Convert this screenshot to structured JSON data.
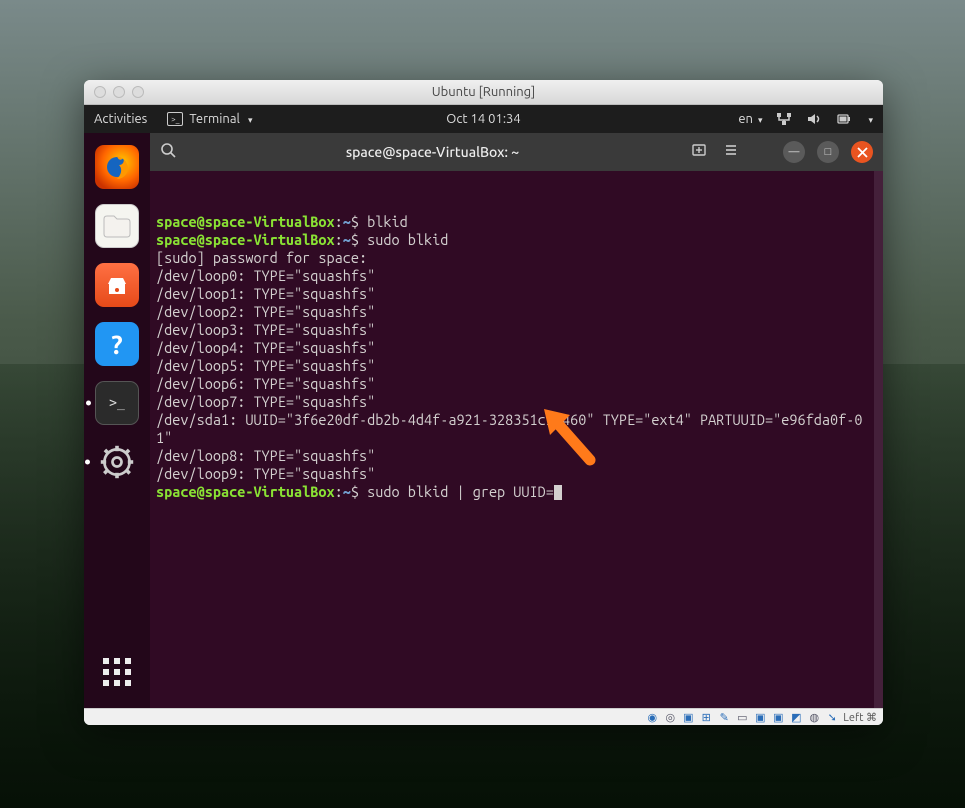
{
  "vm": {
    "title": "Ubuntu [Running]",
    "statusbar_text": "Left ⌘"
  },
  "topbar": {
    "activities": "Activities",
    "app_name": "Terminal",
    "datetime": "Oct 14  01:34",
    "lang": "en"
  },
  "dock": {
    "items": [
      "firefox",
      "files",
      "software",
      "help",
      "terminal",
      "settings",
      "apps"
    ]
  },
  "terminal": {
    "title": "space@space-VirtualBox: ~",
    "prompt_user": "space@space-VirtualBox",
    "prompt_path": "~",
    "lines": [
      {
        "type": "prompt",
        "cmd": "blkid"
      },
      {
        "type": "prompt",
        "cmd": "sudo blkid"
      },
      {
        "type": "out",
        "text": "[sudo] password for space:"
      },
      {
        "type": "out",
        "text": "/dev/loop0: TYPE=\"squashfs\""
      },
      {
        "type": "out",
        "text": "/dev/loop1: TYPE=\"squashfs\""
      },
      {
        "type": "out",
        "text": "/dev/loop2: TYPE=\"squashfs\""
      },
      {
        "type": "out",
        "text": "/dev/loop3: TYPE=\"squashfs\""
      },
      {
        "type": "out",
        "text": "/dev/loop4: TYPE=\"squashfs\""
      },
      {
        "type": "out",
        "text": "/dev/loop5: TYPE=\"squashfs\""
      },
      {
        "type": "out",
        "text": "/dev/loop6: TYPE=\"squashfs\""
      },
      {
        "type": "out",
        "text": "/dev/loop7: TYPE=\"squashfs\""
      },
      {
        "type": "out",
        "text": "/dev/sda1: UUID=\"3f6e20df-db2b-4d4f-a921-328351c93460\" TYPE=\"ext4\" PARTUUID=\"e96fda0f-01\""
      },
      {
        "type": "out",
        "text": "/dev/loop8: TYPE=\"squashfs\""
      },
      {
        "type": "out",
        "text": "/dev/loop9: TYPE=\"squashfs\""
      },
      {
        "type": "prompt",
        "cmd": "sudo blkid | grep UUID=",
        "cursor": true
      }
    ]
  }
}
